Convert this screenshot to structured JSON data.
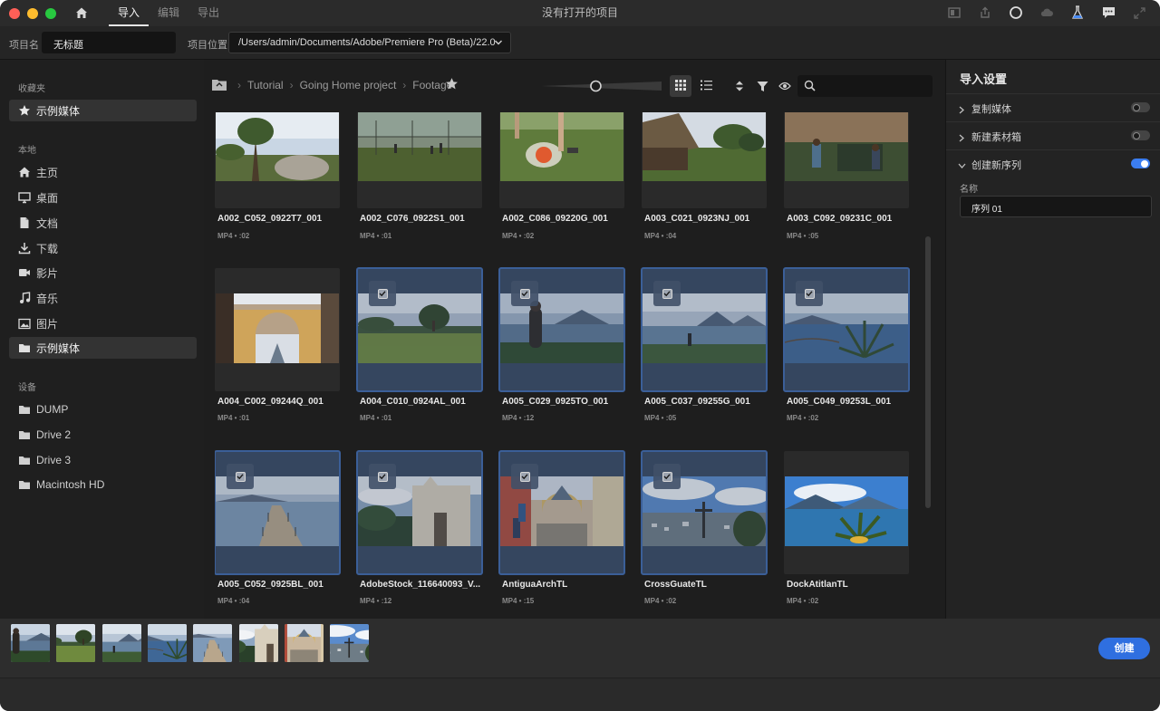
{
  "titlebar": {
    "tabs": [
      {
        "label": "导入",
        "active": true
      },
      {
        "label": "编辑",
        "active": false
      },
      {
        "label": "导出",
        "active": false
      }
    ],
    "title": "没有打开的项目"
  },
  "project": {
    "name_label": "项目名",
    "name_value": "无标题",
    "location_label": "项目位置",
    "location_value": "/Users/admin/Documents/Adobe/Premiere Pro (Beta)/22.0"
  },
  "sidebar": {
    "favorites_heading": "收藏夹",
    "favorites": [
      {
        "label": "示例媒体",
        "icon": "star-icon",
        "selected": true
      }
    ],
    "local_heading": "本地",
    "local": [
      {
        "label": "主页",
        "icon": "home-icon"
      },
      {
        "label": "桌面",
        "icon": "desktop-icon"
      },
      {
        "label": "文档",
        "icon": "document-icon"
      },
      {
        "label": "下载",
        "icon": "download-icon"
      },
      {
        "label": "影片",
        "icon": "video-icon"
      },
      {
        "label": "音乐",
        "icon": "music-icon"
      },
      {
        "label": "图片",
        "icon": "image-icon"
      },
      {
        "label": "示例媒体",
        "icon": "folder-icon",
        "selected": true
      }
    ],
    "devices_heading": "设备",
    "devices": [
      {
        "label": "DUMP",
        "icon": "folder-icon"
      },
      {
        "label": "Drive 2",
        "icon": "folder-icon"
      },
      {
        "label": "Drive 3",
        "icon": "folder-icon"
      },
      {
        "label": "Macintosh HD",
        "icon": "folder-icon"
      }
    ]
  },
  "browser": {
    "breadcrumb": [
      "Tutorial",
      "Going Home project",
      "Footage"
    ],
    "search_placeholder": "",
    "zoom_level": 0.45,
    "clips": [
      {
        "name": "A002_C052_0922T7_001",
        "meta": "MP4 • :02",
        "selected": false,
        "scene": "tree"
      },
      {
        "name": "A002_C076_0922S1_001",
        "meta": "MP4 • :01",
        "selected": false,
        "scene": "field"
      },
      {
        "name": "A002_C086_09220G_001",
        "meta": "MP4 • :02",
        "selected": false,
        "scene": "ball"
      },
      {
        "name": "A003_C021_0923NJ_001",
        "meta": "MP4 • :04",
        "selected": false,
        "scene": "hut"
      },
      {
        "name": "A003_C092_09231C_001",
        "meta": "MP4 • :05",
        "selected": false,
        "scene": "kids"
      },
      {
        "name": "A004_C002_09244Q_001",
        "meta": "MP4 • :01",
        "selected": false,
        "scene": "arch"
      },
      {
        "name": "A004_C010_0924AL_001",
        "meta": "MP4 • :01",
        "selected": true,
        "scene": "lawn"
      },
      {
        "name": "A005_C029_0925TO_001",
        "meta": "MP4 • :12",
        "selected": true,
        "scene": "girl"
      },
      {
        "name": "A005_C037_09255G_001",
        "meta": "MP4 • :05",
        "selected": true,
        "scene": "lake"
      },
      {
        "name": "A005_C049_09253L_001",
        "meta": "MP4 • :02",
        "selected": true,
        "scene": "agave"
      },
      {
        "name": "A005_C052_0925BL_001",
        "meta": "MP4 • :04",
        "selected": true,
        "scene": "pier"
      },
      {
        "name": "AdobeStock_116640093_V...",
        "meta": "MP4 • :12",
        "selected": true,
        "scene": "church"
      },
      {
        "name": "AntiguaArchTL",
        "meta": "MP4 • :15",
        "selected": true,
        "scene": "street"
      },
      {
        "name": "CrossGuateTL",
        "meta": "MP4 • :02",
        "selected": true,
        "scene": "cross"
      },
      {
        "name": "DockAtitlanTL",
        "meta": "MP4 • :02",
        "selected": false,
        "scene": "dock"
      }
    ]
  },
  "settings": {
    "title": "导入设置",
    "rows": [
      {
        "label": "复制媒体",
        "on": false,
        "expanded": false
      },
      {
        "label": "新建素材箱",
        "on": false,
        "expanded": false
      },
      {
        "label": "创建新序列",
        "on": true,
        "expanded": true
      }
    ],
    "name_label": "名称",
    "sequence_name": "序列 01"
  },
  "tray": {
    "scenes": [
      "girl",
      "lawn",
      "lake",
      "agave",
      "pier",
      "church",
      "street",
      "cross"
    ],
    "create_label": "创建"
  },
  "colors": {
    "accent": "#2f6fe0",
    "selection": "#35465f",
    "selection_border": "#3b5f98"
  }
}
